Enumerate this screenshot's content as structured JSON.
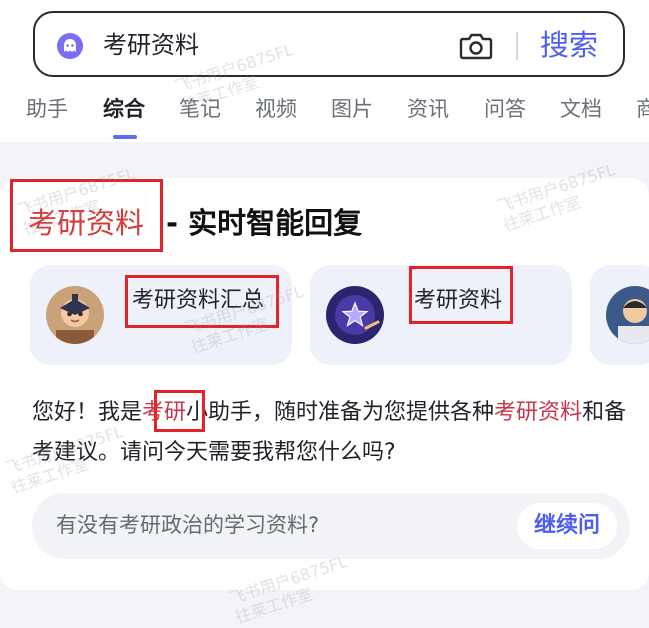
{
  "search": {
    "query": "考研资料",
    "button_label": "搜索"
  },
  "tabs": [
    {
      "label": "助手"
    },
    {
      "label": "综合"
    },
    {
      "label": "笔记"
    },
    {
      "label": "视频"
    },
    {
      "label": "图片"
    },
    {
      "label": "资讯"
    },
    {
      "label": "问答"
    },
    {
      "label": "文档"
    },
    {
      "label": "商"
    }
  ],
  "active_tab": "综合",
  "card": {
    "title_highlight": "考研资料",
    "title_rest": "- 实时智能回复",
    "chips": [
      {
        "label": "考研资料汇总"
      },
      {
        "label": "考研资料"
      }
    ],
    "message": {
      "p1": "您好！我是",
      "p2": "考研",
      "p3": "小助手，随时准备为您提供各种",
      "p4": "考研资料",
      "p5": "和备考建议。请问今天需要我帮您什么吗?"
    },
    "suggestion": {
      "text": "有没有考研政治的学习资料?",
      "button_label": "继续问"
    }
  },
  "watermark": {
    "line1": "飞书用户6875FL",
    "line2": "往莱工作室"
  },
  "colors": {
    "accent": "#4e5ef0",
    "highlight_red": "#e0242a",
    "keyword_red": "#c8364a"
  }
}
